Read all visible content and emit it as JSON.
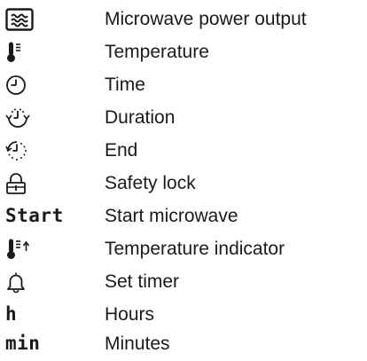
{
  "legend": {
    "rows": [
      {
        "icon": "microwave-power-icon",
        "label": "Microwave power output"
      },
      {
        "icon": "thermometer-icon",
        "label": "Temperature"
      },
      {
        "icon": "clock-icon",
        "label": "Time"
      },
      {
        "icon": "duration-icon",
        "label": "Duration"
      },
      {
        "icon": "end-time-icon",
        "label": "End"
      },
      {
        "icon": "lock-icon",
        "label": "Safety lock"
      },
      {
        "icon": "start-text-icon",
        "symbol_text": "Start",
        "label": "Start microwave"
      },
      {
        "icon": "temperature-indicator-icon",
        "label": "Temperature indicator"
      },
      {
        "icon": "bell-icon",
        "label": "Set timer"
      },
      {
        "icon": "hours-text-icon",
        "symbol_text": "h",
        "label": "Hours"
      },
      {
        "icon": "minutes-text-icon",
        "symbol_text": "min",
        "label": "Minutes"
      }
    ]
  }
}
